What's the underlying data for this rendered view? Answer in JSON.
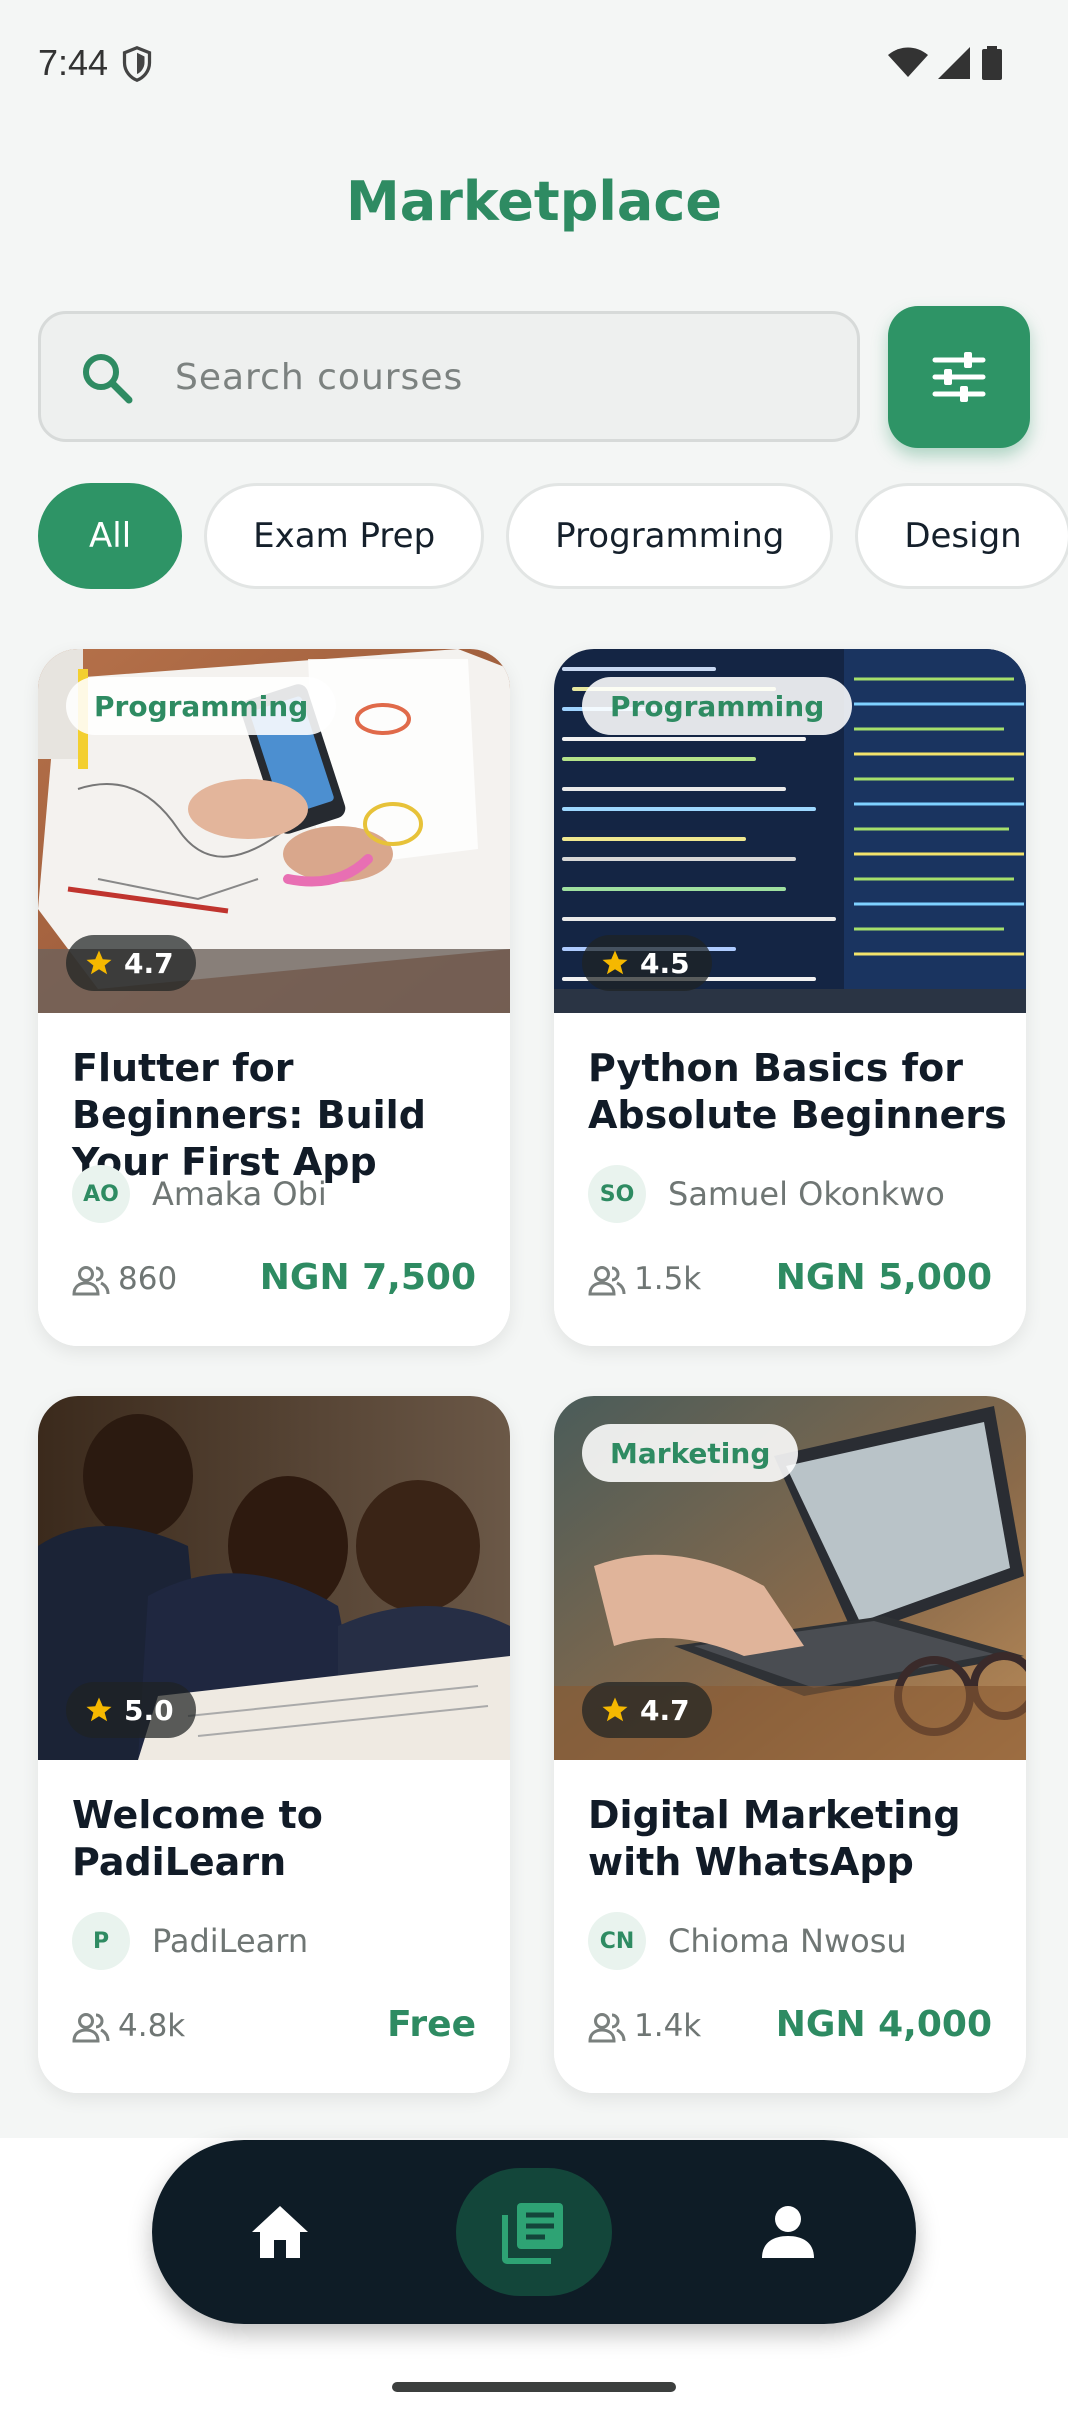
{
  "status_bar": {
    "time": "7:44"
  },
  "header": {
    "title": "Marketplace"
  },
  "search": {
    "placeholder": "Search courses",
    "value": ""
  },
  "categories": [
    "All",
    "Exam Prep",
    "Programming",
    "Design"
  ],
  "selected_category": "All",
  "courses": [
    {
      "tag": "Programming",
      "rating": "4.7",
      "title": "Flutter for Beginners: Build Your First App",
      "author_initials": "AO",
      "author": "Amaka Obi",
      "students": "860",
      "price": "NGN 7,500"
    },
    {
      "tag": "Programming",
      "rating": "4.5",
      "title": "Python Basics for Absolute Beginners",
      "author_initials": "SO",
      "author": "Samuel Okonkwo",
      "students": "1.5k",
      "price": "NGN 5,000"
    },
    {
      "tag": "",
      "rating": "5.0",
      "title": "Welcome to PadiLearn",
      "author_initials": "P",
      "author": "PadiLearn",
      "students": "4.8k",
      "price": "Free"
    },
    {
      "tag": "Marketing",
      "rating": "4.7",
      "title": "Digital Marketing with WhatsApp",
      "author_initials": "CN",
      "author": "Chioma Nwosu",
      "students": "1.4k",
      "price": "NGN 4,000"
    }
  ],
  "nav": [
    {
      "name": "home",
      "icon": "home-icon"
    },
    {
      "name": "courses",
      "icon": "library-books-icon",
      "active": true
    },
    {
      "name": "profile",
      "icon": "person-icon"
    }
  ],
  "colors": {
    "accent": "#2e9466",
    "nav_bg": "#0e1c26"
  }
}
